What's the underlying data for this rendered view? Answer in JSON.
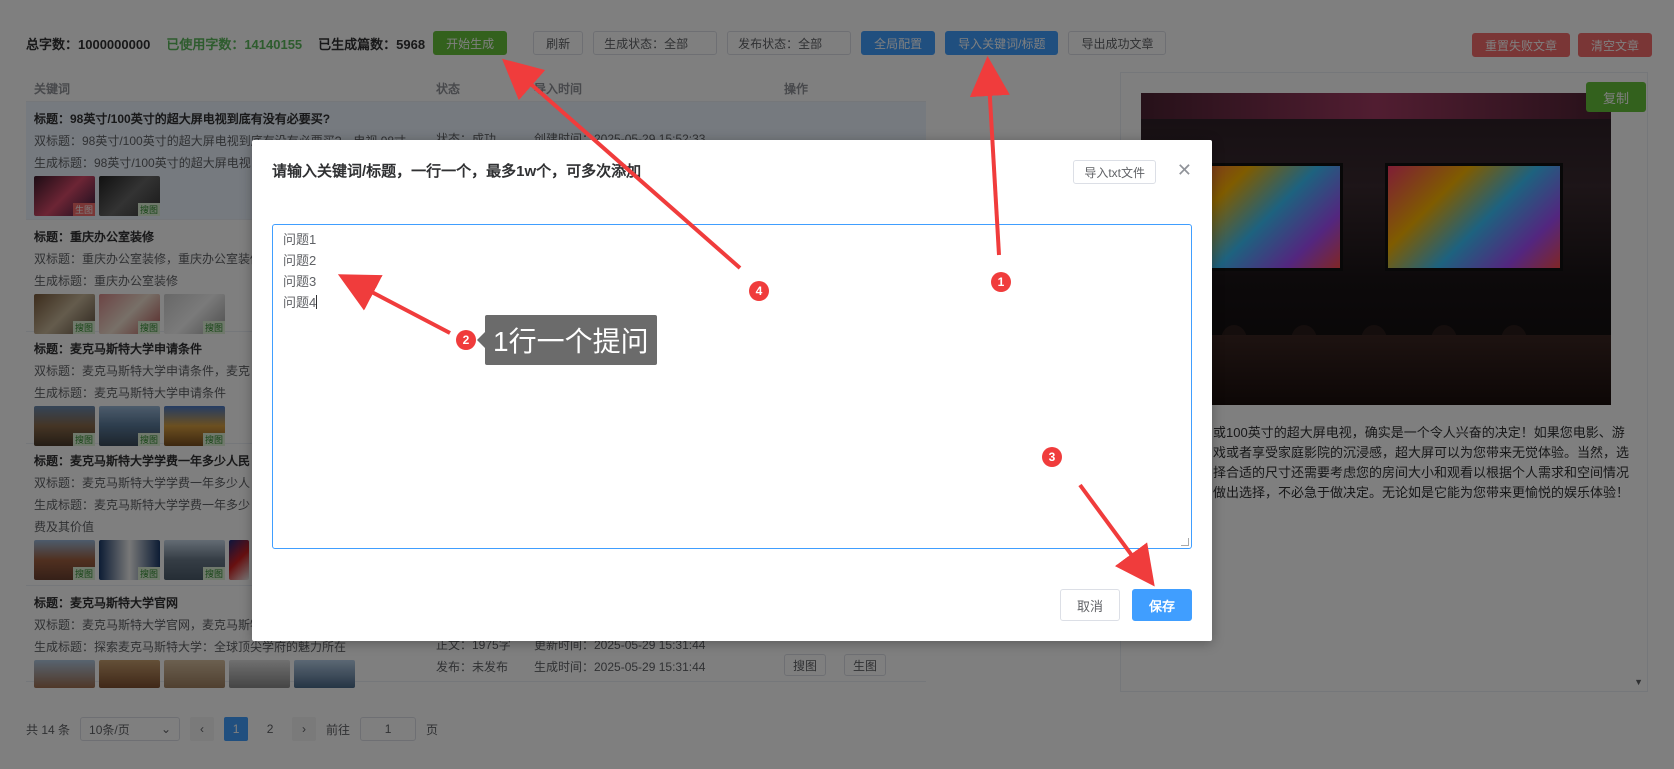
{
  "toolbar": {
    "total_label": "总字数：1000000000",
    "used_label": "已使用字数：14140155",
    "generated_label": "已生成篇数：5968",
    "start_button": "开始生成",
    "refresh_button": "刷新",
    "gen_status_select": "生成状态：全部",
    "publish_status_select": "发布状态：全部",
    "global_config_button": "全局配置",
    "import_button": "导入关键词/标题",
    "export_button": "导出成功文章",
    "reset_failed_button": "重置失败文章",
    "clear_button": "清空文章"
  },
  "table": {
    "headers": {
      "keyword": "关键词",
      "status": "状态",
      "import_time": "导入时间",
      "actions": "操作"
    },
    "rows": [
      {
        "title": "标题：98英寸/100英寸的超大屏电视到底有没有必要买?",
        "double_title": "双标题：98英寸/100英寸的超大屏电视到底有没有必要买?，电视 98寸",
        "gen_title": "生成标题：98英寸/100英寸的超大屏电视",
        "status": "状态：成功",
        "time": "创建时间：2025-05-29 15:52:33",
        "tags": [
          "生图",
          "搜图"
        ]
      },
      {
        "title": "标题：重庆办公室装修",
        "double_title": "双标题：重庆办公室装修，重庆办公室装修",
        "gen_title": "生成标题：重庆办公室装修",
        "tags": [
          "搜图",
          "搜图",
          "搜图"
        ]
      },
      {
        "title": "标题：麦克马斯特大学申请条件",
        "double_title": "双标题：麦克马斯特大学申请条件，麦克",
        "gen_title": "生成标题：麦克马斯特大学申请条件",
        "tags": [
          "搜图",
          "搜图",
          "搜图"
        ]
      },
      {
        "title": "标题：麦克马斯特大学学费一年多少人民",
        "double_title": "双标题：麦克马斯特大学学费一年多少人",
        "gen_title": "生成标题：麦克马斯特大学学费一年多少",
        "extra": "费及其价值",
        "tags": [
          "搜图",
          "搜图",
          "搜图"
        ]
      },
      {
        "title": "标题：麦克马斯特大学官网",
        "double_title": "双标题：麦克马斯特大学官网，麦克马斯特大",
        "gen_title": "生成标题：探索麦克马斯特大学：全球顶尖学府的魅力所在",
        "body_count": "正文：1975字",
        "publish": "发布：未发布",
        "update_time": "更新时间：2025-05-29 15:31:44",
        "gen_time": "生成时间：2025-05-29 15:31:44",
        "search_img": "搜图",
        "gen_img": "生图"
      }
    ]
  },
  "preview": {
    "copy_button": "复制",
    "text": "或100英寸的超大屏电视，确实是一个令人兴奋的决定！如果您电影、游戏或者享受家庭影院的沉浸感，超大屏可以为您带来无觉体验。当然，选择合适的尺寸还需要考虑您的房间大小和观看以根据个人需求和空间情况做出选择，不必急于做决定。无论如是它能为您带来更愉悦的娱乐体验！"
  },
  "pager": {
    "total": "共 14 条",
    "page_size": "10条/页",
    "pages": [
      "1",
      "2"
    ],
    "goto_label": "前往",
    "goto_value": "1",
    "page_suffix": "页"
  },
  "dialog": {
    "title": "请输入关键词/标题，一行一个，最多1w个，可多次添加",
    "import_txt_button": "导入txt文件",
    "lines": [
      "问题1",
      "问题2",
      "问题3",
      "问题4"
    ],
    "cancel_button": "取消",
    "save_button": "保存"
  },
  "annotations": {
    "numbers": [
      "1",
      "2",
      "3",
      "4"
    ],
    "tip": "1行一个提问",
    "color": "#f03c3c"
  }
}
